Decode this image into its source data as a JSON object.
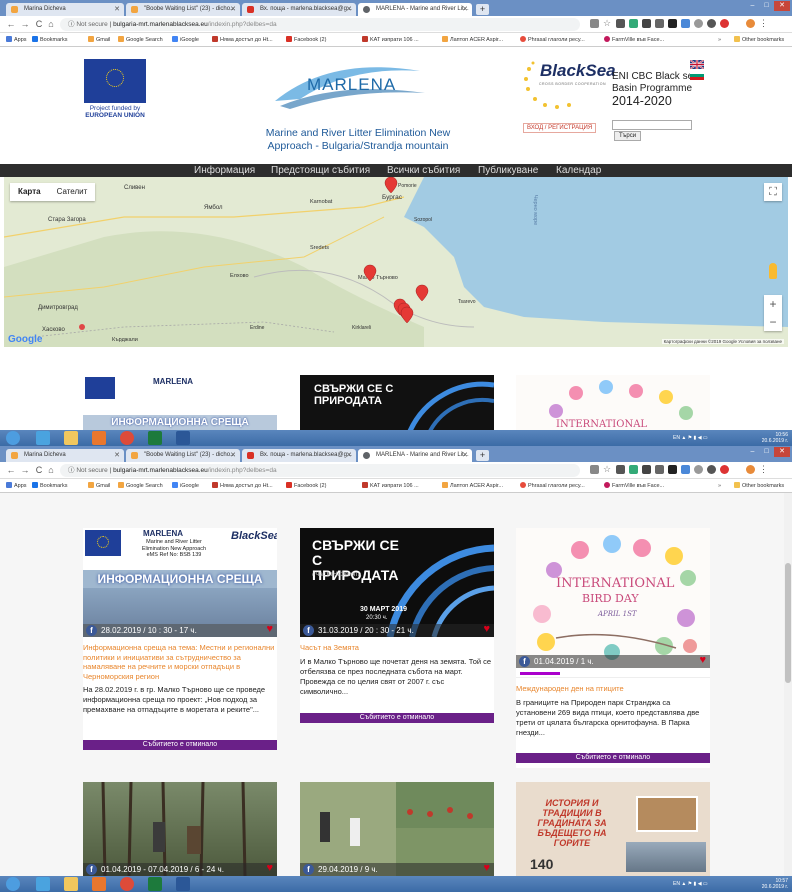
{
  "browser": {
    "tabs": [
      {
        "label": "Marina Dicheva",
        "color": "#f2a541"
      },
      {
        "label": "\"Boobe Waiting List\" (23) - dicho...",
        "color": "#f2a541"
      },
      {
        "label": "Вх. поща - marlena.blacksea@g...",
        "color": "#d93025"
      },
      {
        "label": "MARLENA - Marine and River Lit...",
        "color": "#5f6368"
      }
    ],
    "security": "Not secure",
    "url_main": "bulgaria-mrt.marlenablacksea.eu",
    "url_rest": "/indexin.php?delbes=da",
    "bookmarks": [
      {
        "label": "Apps",
        "color": "#4a7ad8"
      },
      {
        "label": "Bookmarks",
        "color": "#1a73e8"
      },
      {
        "label": "Gmail",
        "color": "#f2a541"
      },
      {
        "label": "Google Search",
        "color": "#f2a541"
      },
      {
        "label": "iGoogle",
        "color": "#4285f4"
      },
      {
        "label": "Няма достъп до Ht...",
        "color": "#c0392b"
      },
      {
        "label": "Facebook (2)",
        "color": "#d93025"
      },
      {
        "label": "KAT изпрати 106 ...",
        "color": "#c0392b"
      },
      {
        "label": "Лаптоп ACER Aspir...",
        "color": "#f2a541"
      },
      {
        "label": "Phrasal глаголи pecy...",
        "color": "#e74c3c"
      },
      {
        "label": "FarmVille във Face...",
        "color": "#c2185b"
      },
      {
        "label": "Other bookmarks",
        "color": "#f2c14e"
      }
    ]
  },
  "header": {
    "eu_caption_1": "Project funded by",
    "eu_caption_2": "EUROPEAN UNION",
    "logo_text": "MARLENA",
    "slogan_1": "Marine and River Litter Elimination New",
    "slogan_2": "Approach - Bulgaria/Strandja mountain",
    "bs_title": "BlackSea",
    "bs_sub": "CROSS BORDER COOPERATION",
    "eni_1": "ENI CBC Black sea",
    "eni_2": "Basin Programme",
    "eni_3": "2014-2020",
    "login_label": "ВХОД / РЕГИСТРАЦИЯ",
    "search_button": "Търси"
  },
  "menu": [
    "Информация",
    "Предстоящи събития",
    "Всички събития",
    "Публикуване",
    "Календар"
  ],
  "map": {
    "type_map": "Карта",
    "type_sat": "Сателит",
    "labels": [
      "Стара Загора",
      "Хасково",
      "Димитровград",
      "Бургас",
      "Малко Търново",
      "Кърджали",
      "Ямбол",
      "Сливен",
      "Pomorie",
      "Sozopol",
      "Елхово",
      "Tsarevo",
      "Erdine",
      "Kirklareli",
      "Karnobat",
      "Sredets",
      "Черно море"
    ],
    "attribution": "Картографски данни ©2019 Google   Условия за ползване",
    "google": "Google"
  },
  "cards": [
    {
      "date": "28.02.2019 / 10 : 30 - 17 ч.",
      "title": "Информационна среща на тема: Местни и регионални политики и инициативи за сътрудничество за намаляване на речните и морски отпадъци в Черноморския регион",
      "desc": "На 28.02.2019 г. в гр. Малко Търново ще се проведе информационна среща по проект: „Нов подход за премахване на отпадъците в моретата и реките\"...",
      "status": "Събитието е отминало",
      "img_heading": "ИНФОРМАЦИОННА СРЕЩА",
      "img_brand": "MARLENA",
      "img_line1": "Marine and River Litter",
      "img_line2": "Elimination New Approach",
      "img_ref": "eMS Ref No: BSB 139"
    },
    {
      "date": "31.03.2019 / 20 : 30 - 21 ч.",
      "title": "Часът на Земята",
      "desc": "И в Малко Търново ще почетат деня на земята. Той се отбелязва се през последната събота на март. Провежда се по целия свят от 2007 г. със символично...",
      "status": "Събитието е отминало",
      "img_heading": "СВЪРЖИ СЕ С ПРИРОДАТА",
      "img_tag": "#ЧасЪтНаЗемята",
      "img_badge": "30 МАРТ 2019",
      "img_time": "20:30 ч."
    },
    {
      "date": "01.04.2019 / 1 ч.",
      "title": "Международен ден на птиците",
      "desc": "В границите на Природен парк Странджа са установени 269 вида птици, което представлява две трети от цялата българска орнитофауна. В Парка гнезди...",
      "status": "Събитието е отминало",
      "img_heading": "INTERNATIONAL",
      "img_line1": "BIRD DAY",
      "img_line2": "APRIL 1ST"
    },
    {
      "date": "01.04.2019 - 07.04.2019 / 6 - 24 ч."
    },
    {
      "date": "29.04.2019 / 9 ч."
    },
    {
      "date": "",
      "img_heading": "ИСТОРИЯ И ТРАДИЦИИ В ГРАДИНАТА ЗА БЪДЕЩЕТО НА ГОРИТЕ",
      "img_num": "140"
    }
  ],
  "taskbar": {
    "lang": "EN",
    "time_1": "10:56",
    "date_1": "20.6.2019 г.",
    "time_2": "10:57",
    "date_2": "20.6.2019 г."
  },
  "colors": {
    "accent": "#6a2088",
    "title_orange": "#e8862d",
    "menu_bg": "#2d2d2d",
    "brand_blue": "#1f5a99"
  }
}
